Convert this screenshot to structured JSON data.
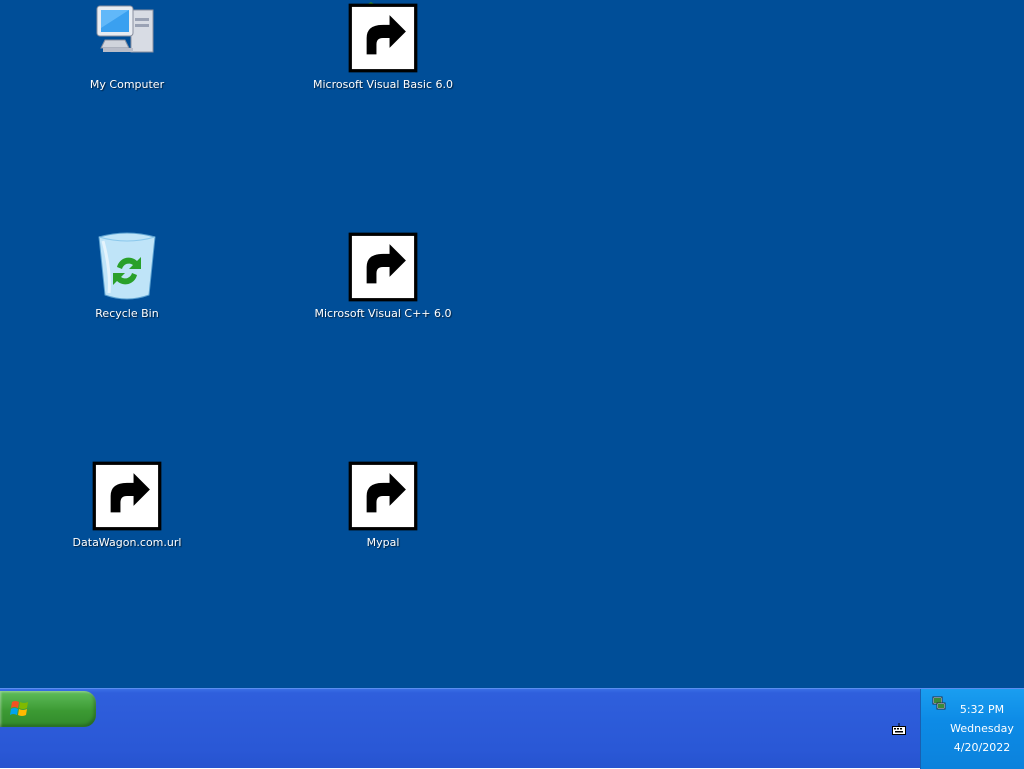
{
  "desktop": {
    "background": "#004e98",
    "icons": [
      {
        "label": "My Computer",
        "icon": "my-computer-icon",
        "shortcut": false
      },
      {
        "label": "Microsoft Visual Basic 6.0",
        "icon": "visual-basic-icon",
        "shortcut": true
      },
      {
        "label": "Recycle Bin",
        "icon": "recycle-bin-icon",
        "shortcut": false
      },
      {
        "label": "Microsoft Visual C++ 6.0",
        "icon": "visual-cpp-icon",
        "shortcut": true
      },
      {
        "label": "DataWagon.com.url",
        "icon": "datawagon-url-icon",
        "shortcut": true
      },
      {
        "label": "Mypal",
        "icon": "mypal-raccoon-icon",
        "shortcut": true
      }
    ]
  },
  "taskbar": {
    "start_button": {
      "icon": "windows-logo-icon",
      "color": "#3c9a33"
    },
    "tray": {
      "time": "5:32 PM",
      "day": "Wednesday",
      "date": "4/20/2022",
      "icons": [
        "network-icon",
        "keyboard-icon"
      ]
    }
  }
}
